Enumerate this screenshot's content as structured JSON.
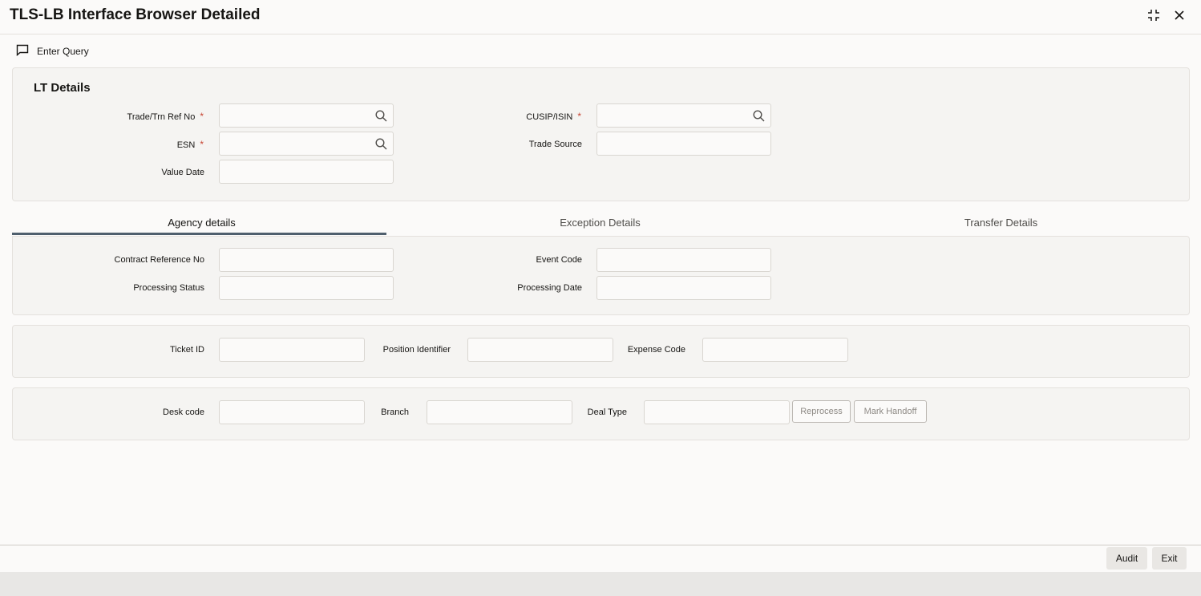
{
  "header": {
    "title": "TLS-LB Interface Browser Detailed"
  },
  "toolbar": {
    "enter_query": "Enter Query"
  },
  "lt_details": {
    "title": "LT Details",
    "trade_ref_label": "Trade/Trn Ref No",
    "cusip_label": "CUSIP/ISIN",
    "esn_label": "ESN",
    "trade_source_label": "Trade Source",
    "value_date_label": "Value Date",
    "required_mark": "*"
  },
  "tabs": [
    {
      "label": "Agency details",
      "active": true
    },
    {
      "label": "Exception Details",
      "active": false
    },
    {
      "label": "Transfer Details",
      "active": false
    }
  ],
  "agency": {
    "contract_ref_label": "Contract Reference No",
    "event_code_label": "Event Code",
    "processing_status_label": "Processing Status",
    "processing_date_label": "Processing Date"
  },
  "ticket": {
    "ticket_id_label": "Ticket ID",
    "position_identifier_label": "Position Identifier",
    "expense_code_label": "Expense Code"
  },
  "desk": {
    "desk_code_label": "Desk code",
    "branch_label": "Branch",
    "deal_type_label": "Deal Type",
    "reprocess_label": "Reprocess",
    "mark_handoff_label": "Mark Handoff"
  },
  "footer": {
    "audit_label": "Audit",
    "exit_label": "Exit"
  },
  "colors": {
    "required": "#c74634",
    "tab_underline": "#4f5f6d"
  }
}
